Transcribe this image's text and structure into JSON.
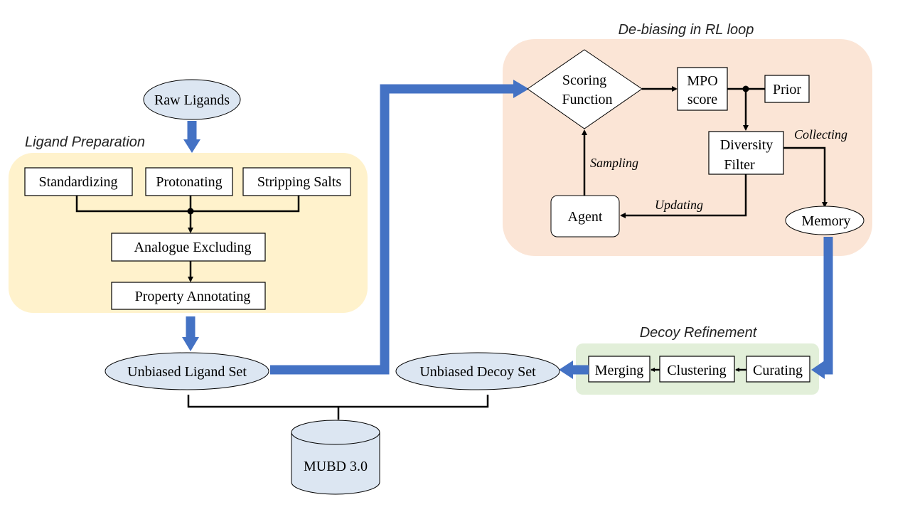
{
  "colors": {
    "arrow": "#4472c4",
    "ligand_panel": "#fff2cc",
    "rl_panel": "#fbe5d6",
    "decoy_panel": "#e2efd9",
    "node_fill": "#dce6f2"
  },
  "raw_ligands": "Raw Ligands",
  "ligand_preparation": {
    "title": "Ligand Preparation",
    "steps": [
      "Standardizing",
      "Protonating",
      "Stripping Salts"
    ],
    "analogue": "Analogue Excluding",
    "property": "Property Annotating"
  },
  "unbiased_ligand_set": "Unbiased Ligand Set",
  "rl_loop": {
    "title": "De-biasing in RL loop",
    "scoring_line1": "Scoring",
    "scoring_line2": "Function",
    "mpo_line1": "MPO",
    "mpo_line2": "score",
    "prior": "Prior",
    "diversity_line1": "Diversity",
    "diversity_line2": "Filter",
    "collecting": "Collecting",
    "memory": "Memory",
    "updating": "Updating",
    "agent": "Agent",
    "sampling": "Sampling"
  },
  "decoy_refinement": {
    "title": "Decoy Refinement",
    "curating": "Curating",
    "clustering": "Clustering",
    "merging": "Merging"
  },
  "unbiased_decoy_set": "Unbiased Decoy Set",
  "database": "MUBD 3.0"
}
